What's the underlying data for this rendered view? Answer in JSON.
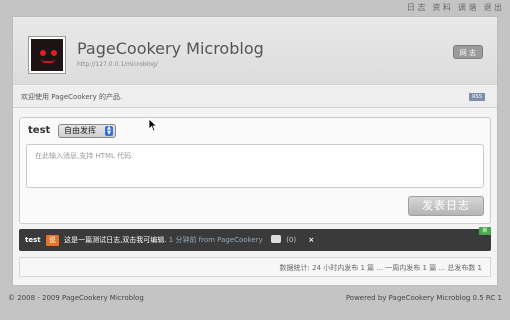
{
  "topnav": [
    "日 志",
    "资 料",
    "调 谐",
    "退 出"
  ],
  "header": {
    "title": "PageCookery Microblog",
    "url": "http://127.0.0.1/microblog/",
    "button": "网 志"
  },
  "welcome": {
    "text": "欢迎使用 PageCookery 的产品.",
    "rss": "RSS"
  },
  "compose": {
    "user": "test",
    "mode": "自由发挥",
    "placeholder": "在此输入消息,支持 HTML 代码.",
    "submit": "发表日志"
  },
  "post": {
    "user": "test",
    "say": "说",
    "text": "这是一篇测试日志,双击我可编辑.",
    "meta": "1 分钟前 from PageCookery",
    "comments": "(0)",
    "delete": "×",
    "badge": "新"
  },
  "stats": "数据统计: 24 小时内发布 1 篇 ... 一周内发布 1 篇 ... 总发布数 1",
  "footer": {
    "left": "© 2008 - 2009 PageCookery Microblog",
    "right": "Powered by PageCookery Microblog 0.5 RC 1"
  },
  "colors": {
    "background": "#c4c4c4",
    "post_bar": "#3a3a3a",
    "say_badge": "#e6732a"
  }
}
